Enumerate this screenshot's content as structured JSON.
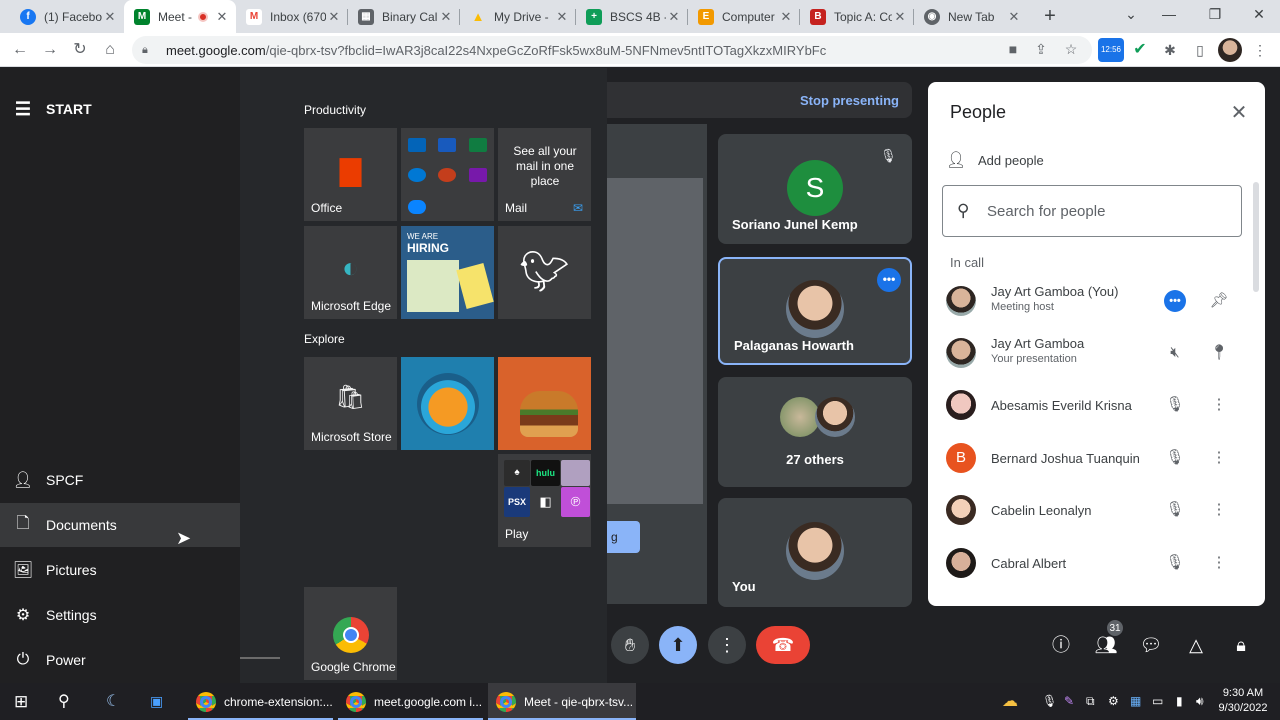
{
  "browser": {
    "tabs": [
      {
        "label": "(1) Facebo",
        "color": "#1877f2",
        "glyph": "f"
      },
      {
        "label": "Meet -",
        "color": "#00832d",
        "glyph": "M",
        "active": true
      },
      {
        "label": "Inbox (670",
        "color": "#ea4335",
        "glyph": "M"
      },
      {
        "label": "Binary Cal",
        "color": "#5f6368",
        "glyph": "▦"
      },
      {
        "label": "My Drive -",
        "color": "#fbbc04",
        "glyph": "▲"
      },
      {
        "label": "BSCS 4B -",
        "color": "#0f9d58",
        "glyph": "+"
      },
      {
        "label": "Computer",
        "color": "#f29900",
        "glyph": "E"
      },
      {
        "label": "Topic A: Co",
        "color": "#c5221f",
        "glyph": "B"
      },
      {
        "label": "New Tab",
        "color": "#5f6368",
        "glyph": "◉"
      }
    ],
    "url_host": "meet.google.com",
    "url_path": "/qie-qbrx-tsv?fbclid=IwAR3j8caI22s4NxpeGcZoRfFsk5wx8uM-5NFNmev5ntITOTagXkzxMIRYbFc",
    "ext_badge": "12:56"
  },
  "meet": {
    "stop_presenting": "Stop presenting",
    "tiles": {
      "t1_name": "Soriano Junel Kemp",
      "t1_initial": "S",
      "t2_name": "Palaganas Howarth",
      "t3_name": "27 others",
      "t4_name": "You"
    },
    "people_badge": "31",
    "pres_fragment": "g"
  },
  "people": {
    "title": "People",
    "add": "Add people",
    "search_placeholder": "Search for people",
    "in_call": "In call",
    "list": [
      {
        "name": "Jay Art Gamboa (You)",
        "sub": "Meeting host"
      },
      {
        "name": "Jay Art Gamboa",
        "sub": "Your presentation"
      },
      {
        "name": "Abesamis Everild Krisna",
        "sub": ""
      },
      {
        "name": "Bernard Joshua Tuanquin",
        "sub": "",
        "initial": "B"
      },
      {
        "name": "Cabelin Leonalyn",
        "sub": ""
      },
      {
        "name": "Cabral Albert",
        "sub": ""
      }
    ]
  },
  "startmenu": {
    "start": "START",
    "left": {
      "user": "SPCF",
      "documents": "Documents",
      "pictures": "Pictures",
      "settings": "Settings",
      "power": "Power"
    },
    "groups": {
      "productivity": "Productivity",
      "explore": "Explore"
    },
    "tiles": {
      "office": "Office",
      "mail": "Mail",
      "mail_text": "See all your mail in one place",
      "edge": "Microsoft Edge",
      "store": "Microsoft Store",
      "play": "Play",
      "chrome": "Google Chrome",
      "hiring_line1": "WE ARE",
      "hiring_line2": "HIRING",
      "hulu": "hulu",
      "psx": "PSX"
    }
  },
  "taskbar": {
    "items": [
      "chrome-extension:...",
      "meet.google.com i...",
      "Meet - qie-qbrx-tsv..."
    ],
    "time": "9:30 AM",
    "date": "9/30/2022"
  }
}
